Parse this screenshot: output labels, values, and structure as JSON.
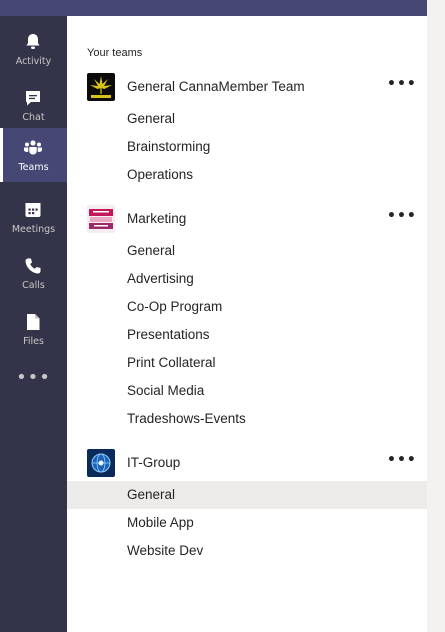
{
  "rail": {
    "items": [
      {
        "label": "Activity",
        "icon": "bell-icon"
      },
      {
        "label": "Chat",
        "icon": "chat-icon"
      },
      {
        "label": "Teams",
        "icon": "teams-icon",
        "active": true
      },
      {
        "label": "Meetings",
        "icon": "calendar-icon"
      },
      {
        "label": "Calls",
        "icon": "phone-icon"
      },
      {
        "label": "Files",
        "icon": "file-icon"
      }
    ],
    "more": "•••"
  },
  "panel": {
    "section_title": "Your teams",
    "teams": [
      {
        "name": "General CannaMember Team",
        "more": "•••",
        "avatar": "canna-leaf-logo",
        "channels": [
          "General",
          "Brainstorming",
          "Operations"
        ]
      },
      {
        "name": "Marketing",
        "more": "•••",
        "avatar": "mobile-marketing-logo",
        "channels": [
          "General",
          "Advertising",
          "Co-Op Program",
          "Presentations",
          "Print Collateral",
          "Social Media",
          "Tradeshows-Events"
        ]
      },
      {
        "name": "IT-Group",
        "more": "•••",
        "avatar": "network-globe-logo",
        "channels": [
          "General",
          "Mobile App",
          "Website Dev"
        ],
        "selected_channel_index": 0
      }
    ]
  },
  "colors": {
    "rail_bg": "#33344a",
    "rail_active": "#464775",
    "top_bar": "#464775",
    "selected_row": "#edebe9",
    "text": "#252423"
  }
}
